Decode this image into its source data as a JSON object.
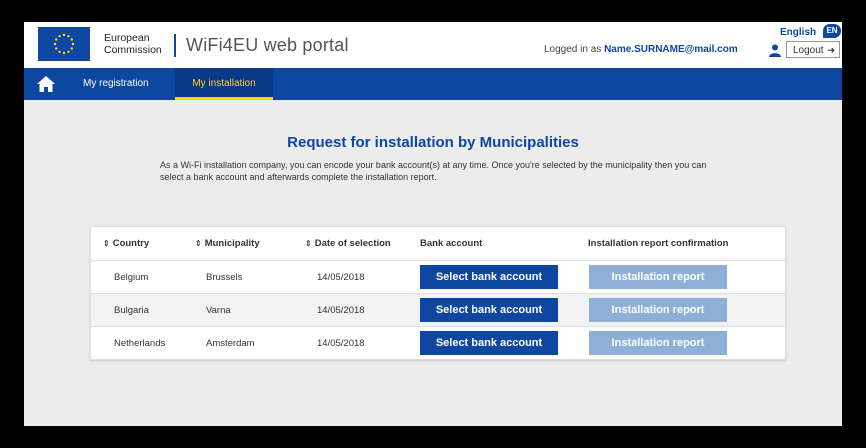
{
  "header": {
    "org_line1": "European",
    "org_line2": "Commission",
    "portal_title": "WiFi4EU web portal",
    "logged_in_prefix": "Logged in as",
    "user_email": "Name.SURNAME@mail.com",
    "language": "English",
    "language_code": "EN",
    "logout_label": "Logout"
  },
  "nav": {
    "items": [
      {
        "label": "My registration"
      },
      {
        "label": "My installation",
        "active": true
      }
    ]
  },
  "main": {
    "title": "Request for installation by Municipalities",
    "intro": "As a Wi-Fi installation company, you can encode your bank account(s) at any time. Once you're selected by the municipality then you can select a bank account and afterwards complete the installation report.",
    "table": {
      "columns": [
        "Country",
        "Municipality",
        "Date of selection",
        "Bank account",
        "Installation report confirmation"
      ],
      "rows": [
        {
          "country": "Belgium",
          "municipality": "Brussels",
          "date": "14/05/2018",
          "bank_button": "Select bank account",
          "report_button": "Installation report"
        },
        {
          "country": "Bulgaria",
          "municipality": "Varna",
          "date": "14/05/2018",
          "bank_button": "Select bank account",
          "report_button": "Installation report"
        },
        {
          "country": "Netherlands",
          "municipality": "Amsterdam",
          "date": "14/05/2018",
          "bank_button": "Select bank account",
          "report_button": "Installation report"
        }
      ]
    }
  },
  "colors": {
    "brand_blue": "#0e47a1",
    "accent_yellow": "#ffd617",
    "report_button": "#8fb0d6"
  }
}
